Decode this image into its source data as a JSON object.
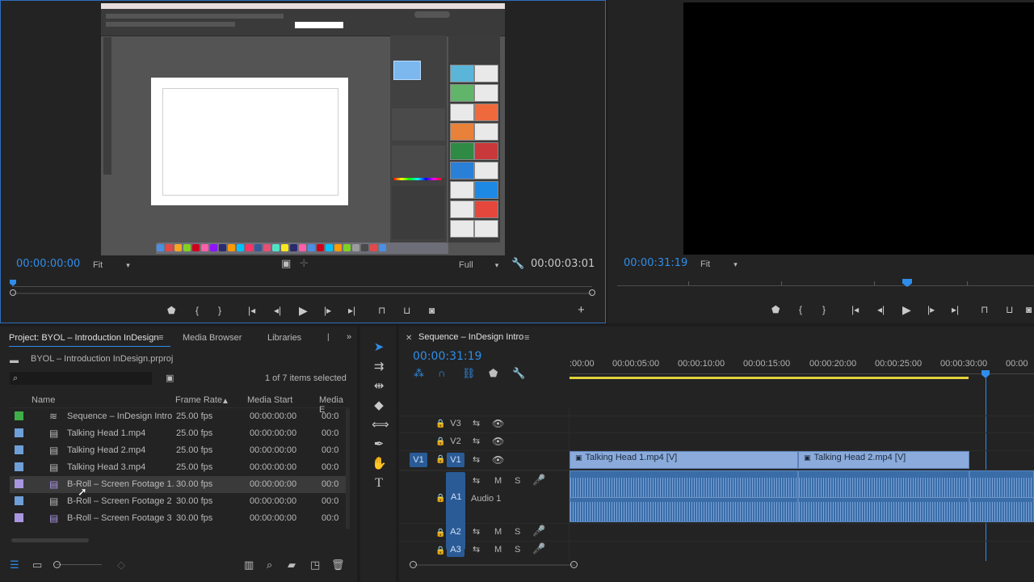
{
  "source_monitor": {
    "timecode_in": "00:00:00:00",
    "zoom": "Fit",
    "resolution": "Full",
    "timecode_duration": "00:00:03:01"
  },
  "program_monitor": {
    "timecode": "00:00:31:19",
    "zoom": "Fit"
  },
  "project": {
    "tabs": [
      "Project: BYOL – Introduction InDesign",
      "Media Browser",
      "Libraries"
    ],
    "file": "BYOL – Introduction InDesign.prproj",
    "selection_status": "1 of 7 items selected",
    "columns": [
      "Name",
      "Frame Rate",
      "Media Start",
      "Media E"
    ],
    "rows": [
      {
        "name": "Sequence – InDesign Intro",
        "rate": "25.00 fps",
        "start": "00:00:00:00",
        "end": "00:0"
      },
      {
        "name": "Talking Head 1.mp4",
        "rate": "25.00 fps",
        "start": "00:00:00:00",
        "end": "00:0"
      },
      {
        "name": "Talking Head 2.mp4",
        "rate": "25.00 fps",
        "start": "00:00:00:00",
        "end": "00:0"
      },
      {
        "name": "Talking Head 3.mp4",
        "rate": "25.00 fps",
        "start": "00:00:00:00",
        "end": "00:0"
      },
      {
        "name": "B-Roll – Screen Footage 1.",
        "rate": "30.00 fps",
        "start": "00:00:00:00",
        "end": "00:0"
      },
      {
        "name": "B-Roll – Screen Footage 2",
        "rate": "30.00 fps",
        "start": "00:00:00:00",
        "end": "00:0"
      },
      {
        "name": "B-Roll – Screen Footage 3",
        "rate": "30.00 fps",
        "start": "00:00:00:00",
        "end": "00:0"
      }
    ]
  },
  "timeline": {
    "title": "Sequence – InDesign Intro",
    "timecode": "00:00:31:19",
    "ruler": [
      ":00:00",
      "00:00:05:00",
      "00:00:10:00",
      "00:00:15:00",
      "00:00:20:00",
      "00:00:25:00",
      "00:00:30:00",
      "00:00"
    ],
    "tracks": {
      "v3": "V3",
      "v2": "V2",
      "v1_src": "V1",
      "v1": "V1",
      "a1": "A1",
      "a1_name": "Audio 1",
      "a2": "A2",
      "a3": "A3",
      "mute": "M",
      "solo": "S"
    },
    "clips": {
      "v1_a": "Talking Head 1.mp4 [V]",
      "v1_b": "Talking Head 2.mp4 [V]"
    }
  },
  "colors": {
    "accent": "#2f8dea",
    "clip_video": "#8aabdb",
    "clip_audio": "#3a6da8",
    "label_sequence": "#3fae49",
    "label_talking_head": "#6f9fd8",
    "label_broll": "#a996e0",
    "work_area": "#e2d23b"
  }
}
